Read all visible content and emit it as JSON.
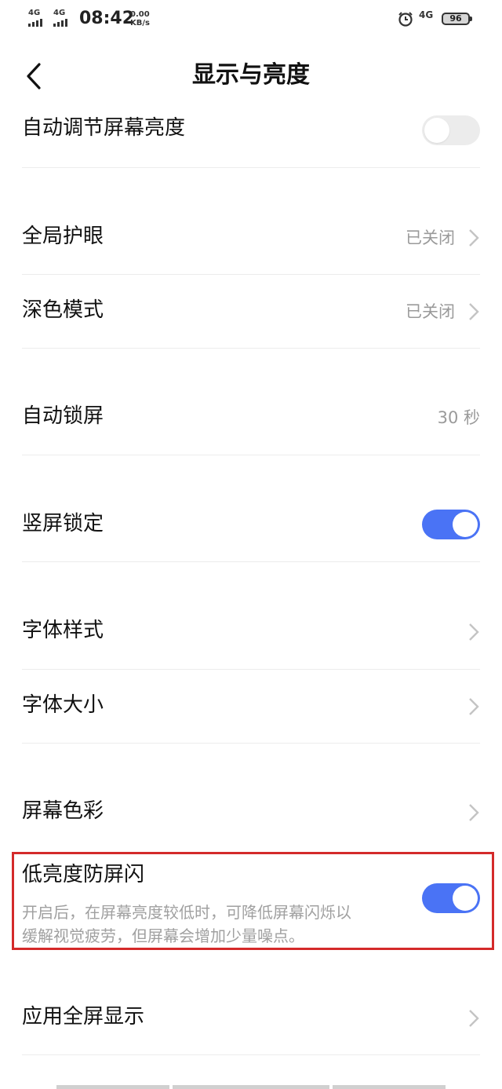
{
  "status_bar": {
    "sim1": "4G",
    "sim2": "4G",
    "time": "08:42",
    "speed_value": "0.00",
    "speed_unit": "KB/s",
    "network": "4G",
    "battery": "96"
  },
  "header": {
    "title": "显示与亮度"
  },
  "settings": {
    "auto_brightness": {
      "label": "自动调节屏幕亮度",
      "enabled": false
    },
    "global_eye_care": {
      "label": "全局护眼",
      "value": "已关闭"
    },
    "dark_mode": {
      "label": "深色模式",
      "value": "已关闭"
    },
    "auto_lock": {
      "label": "自动锁屏",
      "value": "30 秒"
    },
    "portrait_lock": {
      "label": "竖屏锁定",
      "enabled": true
    },
    "font_style": {
      "label": "字体样式"
    },
    "font_size": {
      "label": "字体大小"
    },
    "screen_color": {
      "label": "屏幕色彩"
    },
    "low_brightness_flicker": {
      "label": "低亮度防屏闪",
      "description_line1": "开启后，在屏幕亮度较低时，可降低屏幕闪烁以",
      "description_line2": "缓解视觉疲劳，但屏幕会增加少量噪点。",
      "enabled": true
    },
    "app_fullscreen": {
      "label": "应用全屏显示"
    }
  },
  "colors": {
    "toggle_on": "#4a73f5",
    "toggle_off": "#ececec",
    "highlight_border": "#d42a2a",
    "secondary_text": "#9a9a9a"
  }
}
